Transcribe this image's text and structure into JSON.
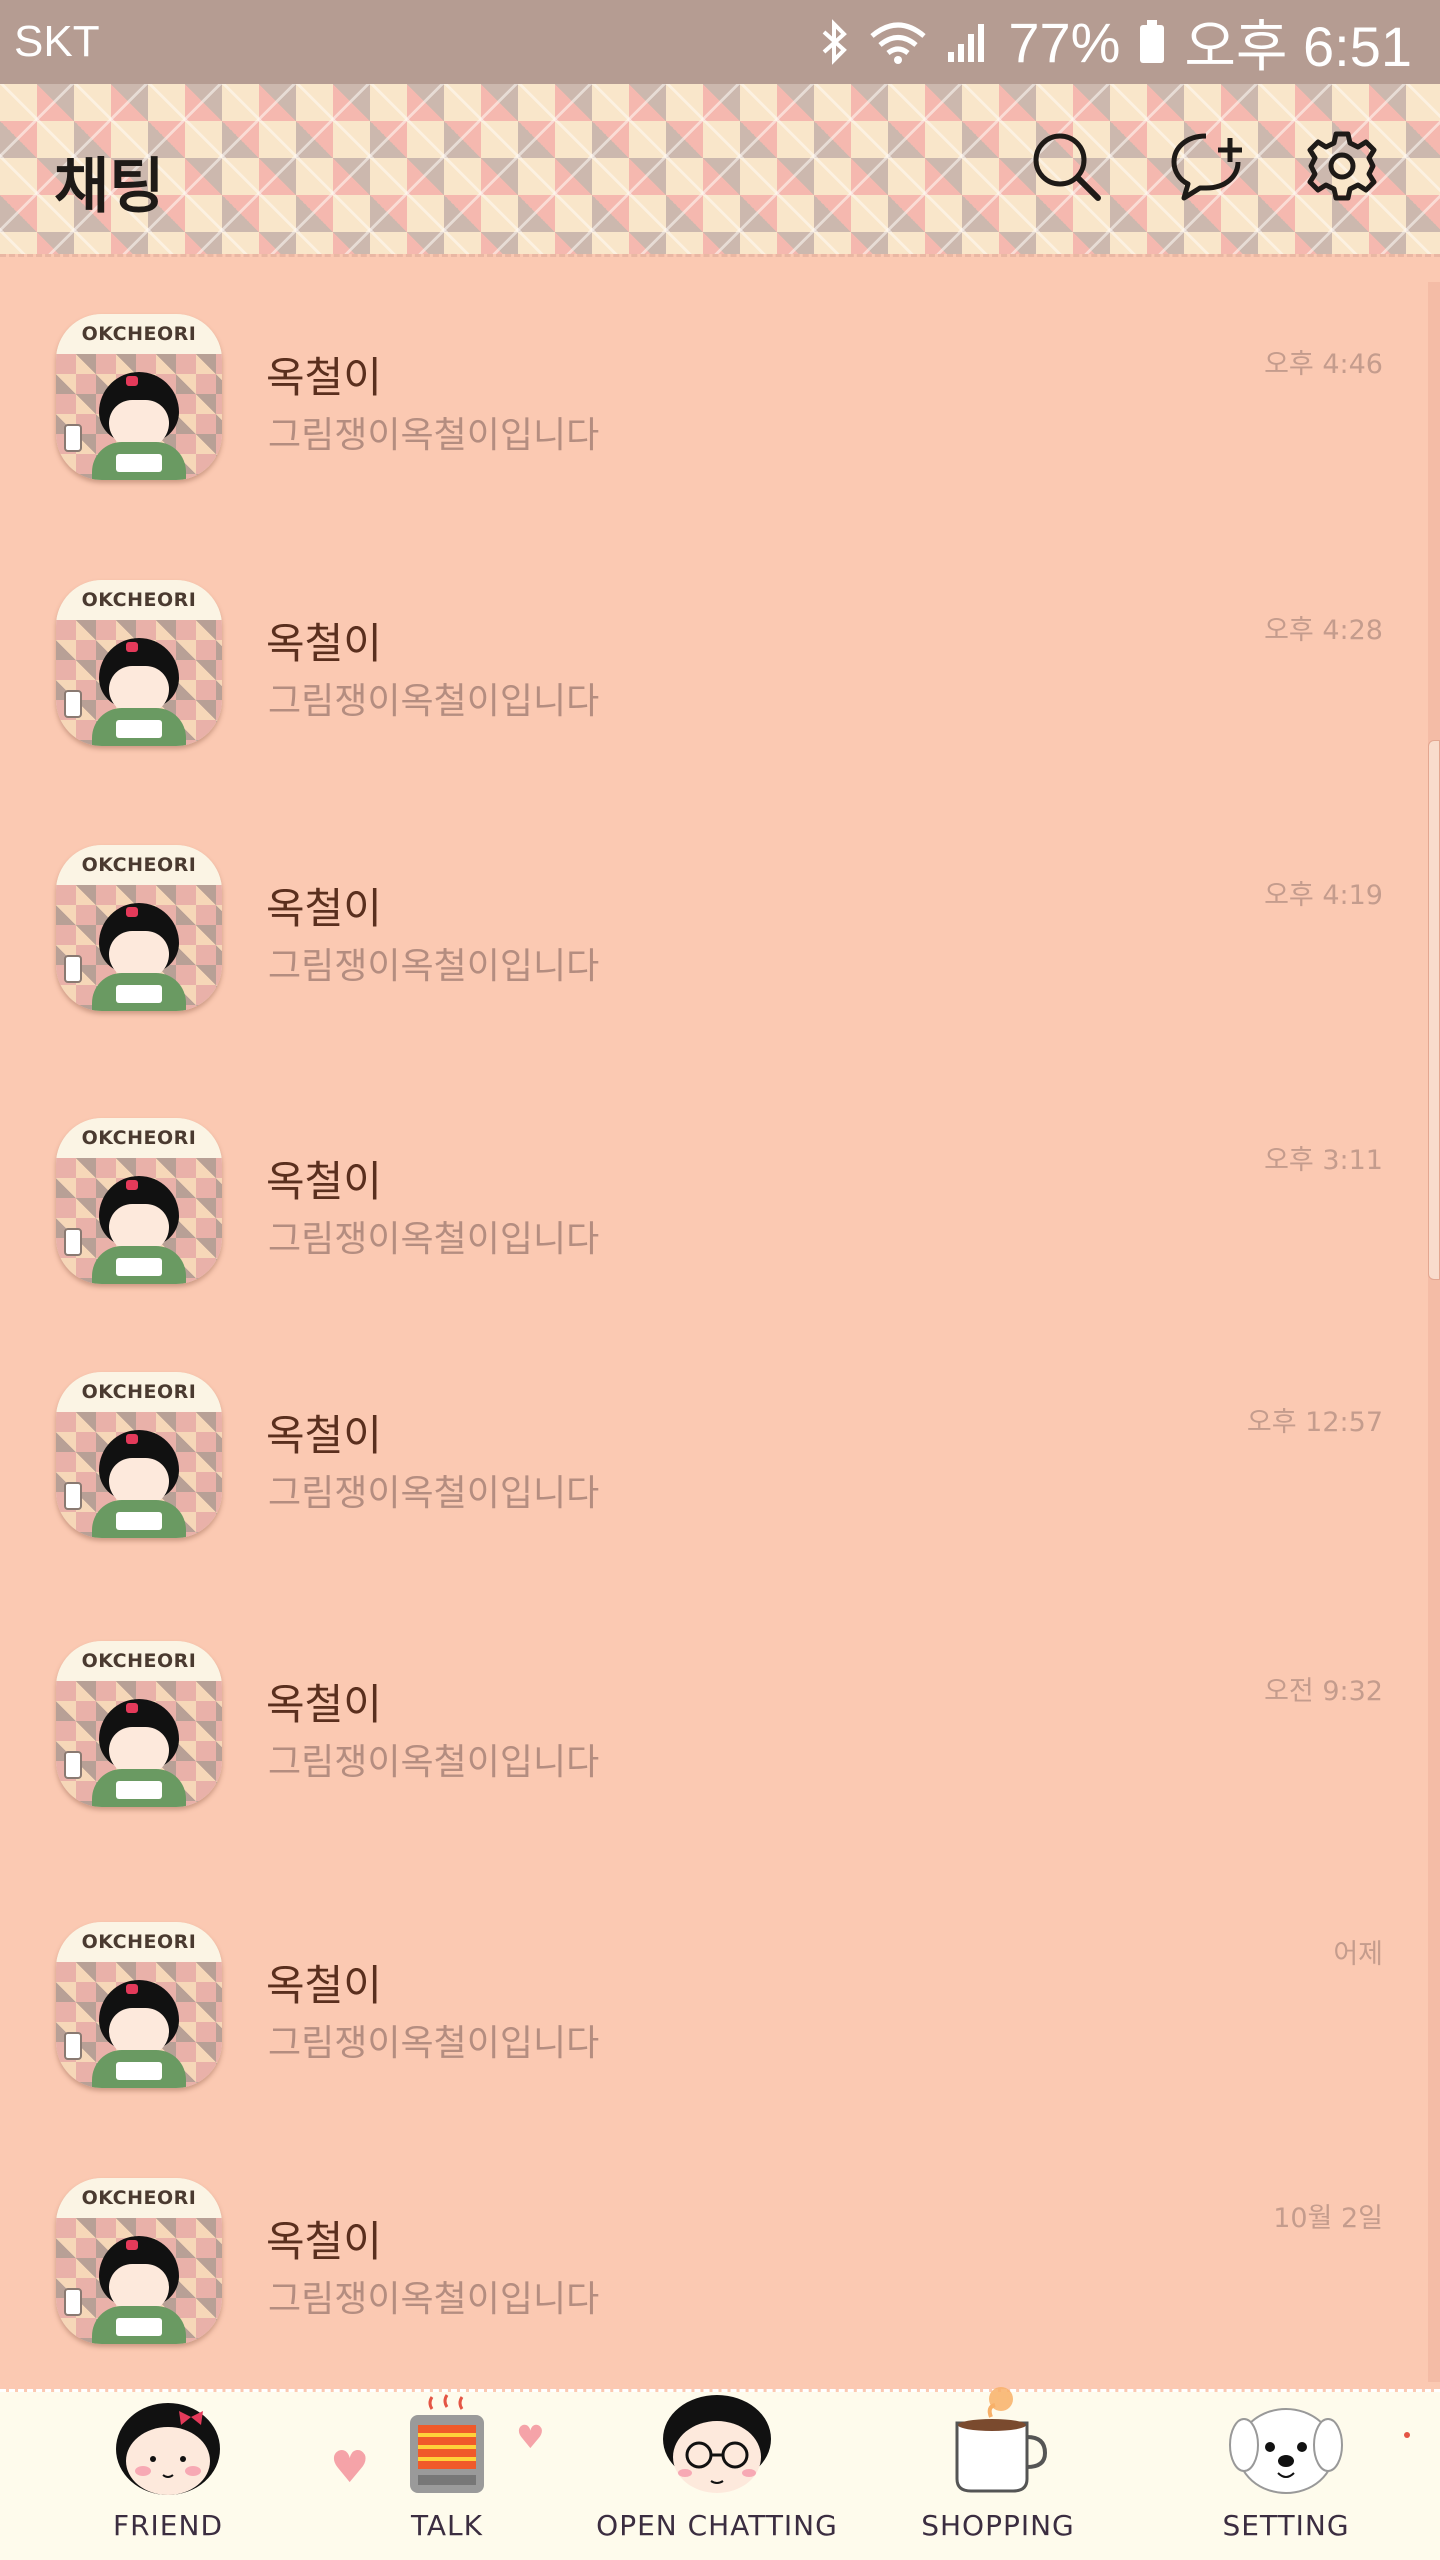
{
  "status_bar": {
    "carrier": "SKT",
    "battery": "77%",
    "time": "오후 6:51",
    "icons": [
      "bluetooth-icon",
      "wifi-icon",
      "signal-icon",
      "battery-icon"
    ]
  },
  "header": {
    "title": "채팅",
    "actions": [
      "search-icon",
      "new-chat-icon",
      "settings-gear-icon"
    ]
  },
  "avatar_label": "OKCHEORI",
  "chats": [
    {
      "name": "옥철이",
      "message": "그림쟁이옥철이입니다",
      "time": "오후 4:46"
    },
    {
      "name": "옥철이",
      "message": "그림쟁이옥철이입니다",
      "time": "오후 4:28"
    },
    {
      "name": "옥철이",
      "message": "그림쟁이옥철이입니다",
      "time": "오후 4:19"
    },
    {
      "name": "옥철이",
      "message": "그림쟁이옥철이입니다",
      "time": "오후 3:11"
    },
    {
      "name": "옥철이",
      "message": "그림쟁이옥철이입니다",
      "time": "오후 12:57"
    },
    {
      "name": "옥철이",
      "message": "그림쟁이옥철이입니다",
      "time": "오전 9:32"
    },
    {
      "name": "옥철이",
      "message": "그림쟁이옥철이입니다",
      "time": "어제"
    },
    {
      "name": "옥철이",
      "message": "그림쟁이옥철이입니다",
      "time": "10월 2일"
    }
  ],
  "bottom_nav": [
    {
      "label": "FRIEND",
      "icon": "girl-face-icon"
    },
    {
      "label": "TALK",
      "icon": "heater-icon"
    },
    {
      "label": "OPEN CHATTING",
      "icon": "boy-glasses-icon"
    },
    {
      "label": "SHOPPING",
      "icon": "coffee-cup-icon"
    },
    {
      "label": "SETTING",
      "icon": "puppy-icon"
    }
  ],
  "colors": {
    "background": "#fbc9b2",
    "status_bar": "#b59c92",
    "name_text": "#5a2f1e",
    "message_text": "#b48d80",
    "time_text": "#c49c8d",
    "nav_background": "#fefbec"
  }
}
